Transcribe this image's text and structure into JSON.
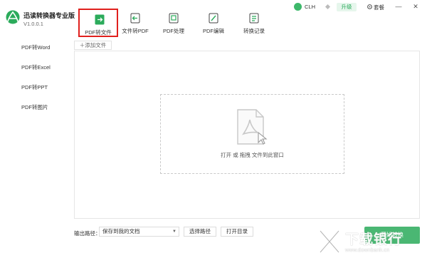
{
  "app": {
    "title": "迅读转换器专业版",
    "version": "V1.0.0.1"
  },
  "tabs": [
    {
      "label": "PDF转文件",
      "active": true
    },
    {
      "label": "文件转PDF"
    },
    {
      "label": "PDF处理"
    },
    {
      "label": "PDF编辑"
    },
    {
      "label": "转换记录"
    }
  ],
  "user": {
    "name": "CLH",
    "upgrade_label": "升级",
    "settings_label": "套餐"
  },
  "window": {
    "minimize": "—",
    "close": "✕"
  },
  "sidebar": {
    "items": [
      {
        "label": "PDF转Word"
      },
      {
        "label": "PDF转Excel"
      },
      {
        "label": "PDF转PPT"
      },
      {
        "label": "PDF转图片"
      }
    ]
  },
  "main": {
    "add_file_label": "＋添加文件",
    "drop_text": "打开 或 拖拽 文件到此窗口"
  },
  "bottom": {
    "output_label": "输出路径：",
    "output_value": "保存到我的文档",
    "choose_path_label": "选择路径",
    "open_dir_label": "打开目录",
    "start_label": "开始转换"
  },
  "watermark": {
    "text": "下载银行",
    "url": "www.downbank.cn"
  },
  "colors": {
    "accent": "#2bab5b",
    "active_border": "#e0201d"
  },
  "icons": {
    "logo": "app-logo-icon",
    "settings": "gear-icon",
    "diamond": "diamond-icon"
  }
}
